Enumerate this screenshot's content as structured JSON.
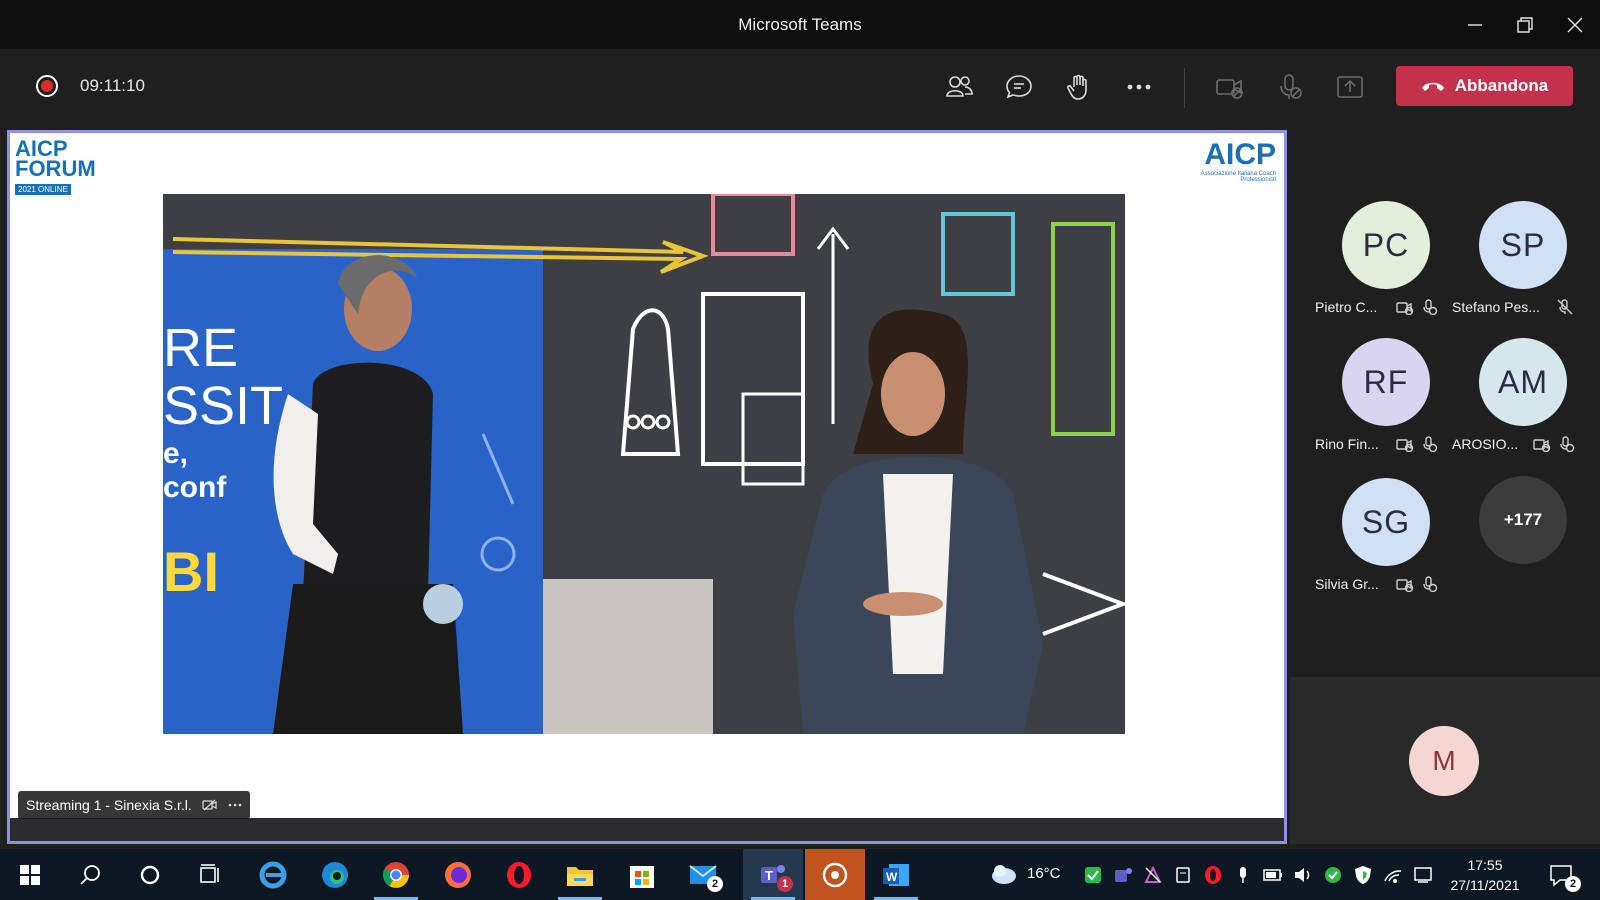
{
  "window": {
    "title": "Microsoft Teams"
  },
  "meeting": {
    "timer": "09:11:10",
    "leave_label": "Abbandona",
    "stream_label": "Streaming 1 - Sinexia S.r.l."
  },
  "stage": {
    "logo_left": "AICP FORUM",
    "logo_left_sub": "2021 ONLINE",
    "logo_right": "AICP",
    "logo_right_sub": "Associazione Italiana Coach Professionisti",
    "slide_text_1": "RE",
    "slide_text_2": "SSIT",
    "slide_text_3": "e,",
    "slide_text_4": "conf",
    "slide_text_5": "BI"
  },
  "participants": [
    {
      "initials": "PC",
      "name": "Pietro C...",
      "color": "#e3eedb"
    },
    {
      "initials": "SP",
      "name": "Stefano Pes...",
      "color": "#cfe0f5"
    },
    {
      "initials": "RF",
      "name": "Rino Fin...",
      "color": "#d9d4ef"
    },
    {
      "initials": "AM",
      "name": "AROSIO...",
      "color": "#d5e6ec"
    },
    {
      "initials": "SG",
      "name": "Silvia Gr...",
      "color": "#cfe0f5"
    }
  ],
  "more_participants": "+177",
  "self": {
    "initials": "M"
  },
  "taskbar": {
    "weather": "16°C",
    "time": "17:55",
    "date": "27/11/2021",
    "mail_badge": "2",
    "teams_badge": "1",
    "notif_badge": "2"
  }
}
